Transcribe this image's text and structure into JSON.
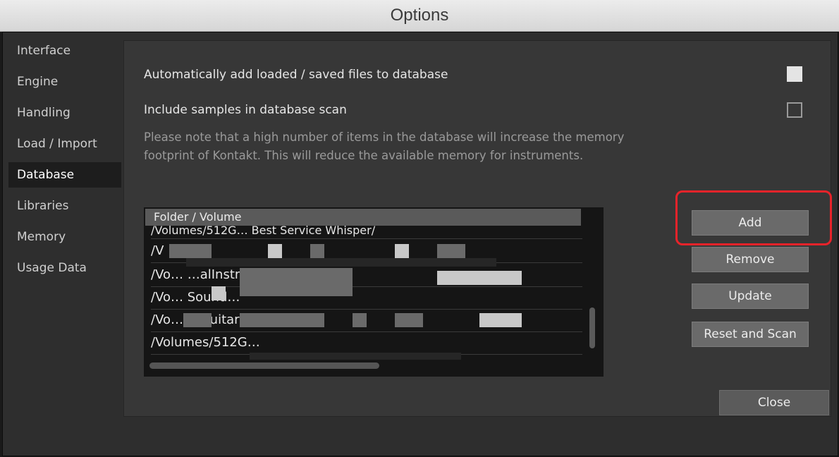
{
  "window": {
    "title": "Options"
  },
  "sidebar": {
    "items": [
      {
        "label": "Interface"
      },
      {
        "label": "Engine"
      },
      {
        "label": "Handling"
      },
      {
        "label": "Load / Import"
      },
      {
        "label": "Database",
        "active": true
      },
      {
        "label": "Libraries"
      },
      {
        "label": "Memory"
      },
      {
        "label": "Usage Data"
      }
    ]
  },
  "database": {
    "auto_add_label": "Automatically add loaded / saved files to database",
    "auto_add_checked": true,
    "include_samples_label": "Include samples in database scan",
    "include_samples_checked": false,
    "note": "Please note that a high number of items in the database will increase the memory footprint of Kontakt. This will reduce the available memory for instruments.",
    "list": {
      "header": "Folder / Volume",
      "rows": [
        "/Volumes/512G… Best Service Whisper/",
        "/V",
        "/Vo… …alInstruments/",
        "/Vo… Sound…",
        "/Vo… …Guitar Str",
        "/Volumes/512G…"
      ]
    },
    "buttons": {
      "add": "Add",
      "remove": "Remove",
      "update": "Update",
      "reset_scan": "Reset and Scan"
    }
  },
  "footer": {
    "close": "Close"
  },
  "colors": {
    "highlight": "#e8232a",
    "active_bg": "#1d1d1d",
    "button_bg": "#6a6a6a"
  }
}
